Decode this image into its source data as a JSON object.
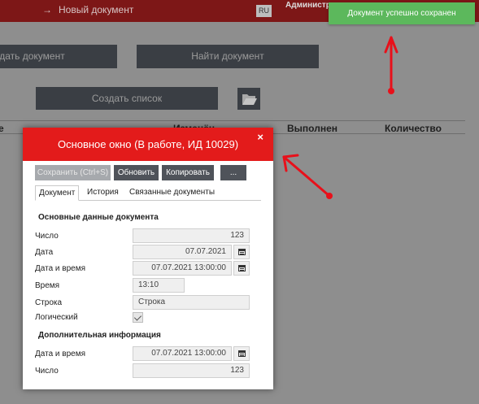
{
  "topbar": {
    "crumb_arrow": "→",
    "crumb_text": "Новый документ",
    "lang": "RU",
    "user": "Администратор"
  },
  "background": {
    "create_doc": "здать документ",
    "find_doc": "Найти документ",
    "create_list": "Создать список",
    "folder_icon": "folder-open",
    "columns": [
      "е",
      "Изменён",
      "Выполнен",
      "Количество"
    ]
  },
  "dialog": {
    "title": "Основное окно (В работе, ИД 10029)",
    "close": "×",
    "toolbar": {
      "save": "Сохранить (Ctrl+S)",
      "refresh": "Обновить",
      "copy": "Копировать",
      "more": "..."
    },
    "tabs": [
      "Документ",
      "История",
      "Связанные документы"
    ],
    "main_section": "Основные данные документа",
    "fields": {
      "number": {
        "label": "Число",
        "value": "123"
      },
      "date": {
        "label": "Дата",
        "value": "07.07.2021"
      },
      "datetime": {
        "label": "Дата и время",
        "value": "07.07.2021 13:00:00"
      },
      "time": {
        "label": "Время",
        "value": "13:10"
      },
      "string": {
        "label": "Строка",
        "value": "Строка"
      },
      "logical": {
        "label": "Логический",
        "checked": true
      }
    },
    "extra_section": "Дополнительная информация",
    "extra_fields": {
      "datetime": {
        "label": "Дата и время",
        "value": "07.07.2021 13:00:00"
      },
      "number": {
        "label": "Число",
        "value": "123"
      }
    }
  },
  "toast": {
    "text": "Документ успешно сохранен",
    "color": "#5cb85c"
  },
  "colors": {
    "header_red": "#e31b1b",
    "annotation_red": "#e8101a"
  }
}
